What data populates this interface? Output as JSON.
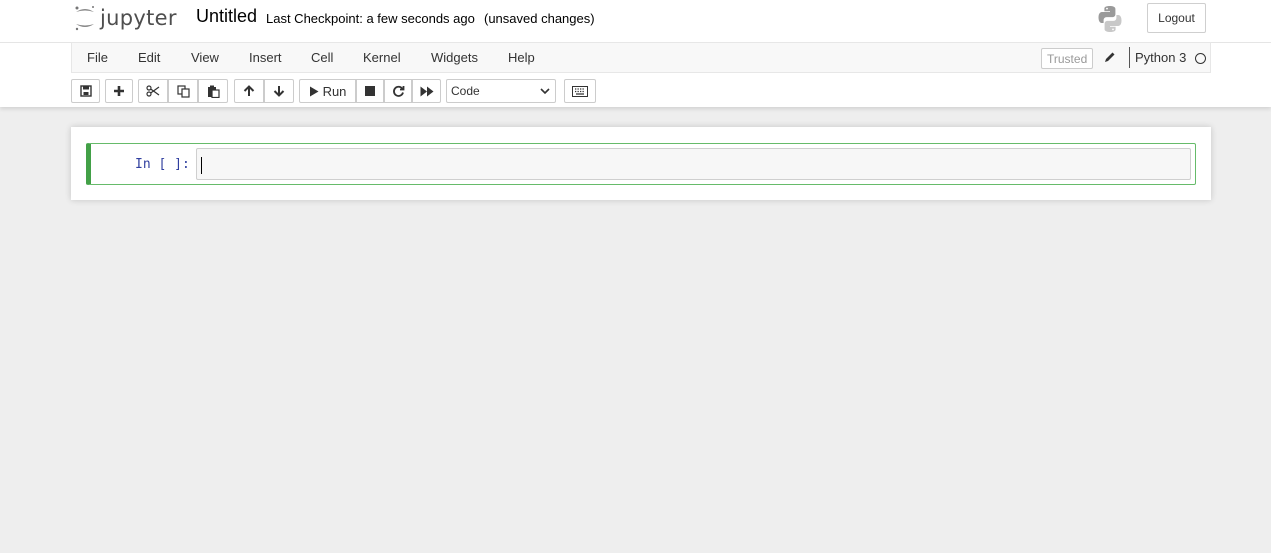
{
  "header": {
    "logo_text": "jupyter",
    "notebook_title": "Untitled",
    "checkpoint": "Last Checkpoint: a few seconds ago",
    "save_status": "(unsaved changes)",
    "logout_label": "Logout"
  },
  "menubar": {
    "items": [
      "File",
      "Edit",
      "View",
      "Insert",
      "Cell",
      "Kernel",
      "Widgets",
      "Help"
    ],
    "trusted_label": "Trusted",
    "kernel_name": "Python 3"
  },
  "toolbar": {
    "run_label": "Run",
    "cell_type": "Code",
    "icons": [
      "save-icon",
      "plus-icon",
      "cut-icon",
      "copy-icon",
      "paste-icon",
      "arrow-up-icon",
      "arrow-down-icon",
      "play-icon",
      "stop-icon",
      "restart-icon",
      "fast-forward-icon",
      "keyboard-icon"
    ]
  },
  "cell": {
    "prompt": "In [ ]:",
    "content": ""
  },
  "colors": {
    "jupyter_orange": "#f37726",
    "cell_selected_border": "#42a047",
    "prompt_color": "#303f9f",
    "background": "#eeeeee"
  }
}
